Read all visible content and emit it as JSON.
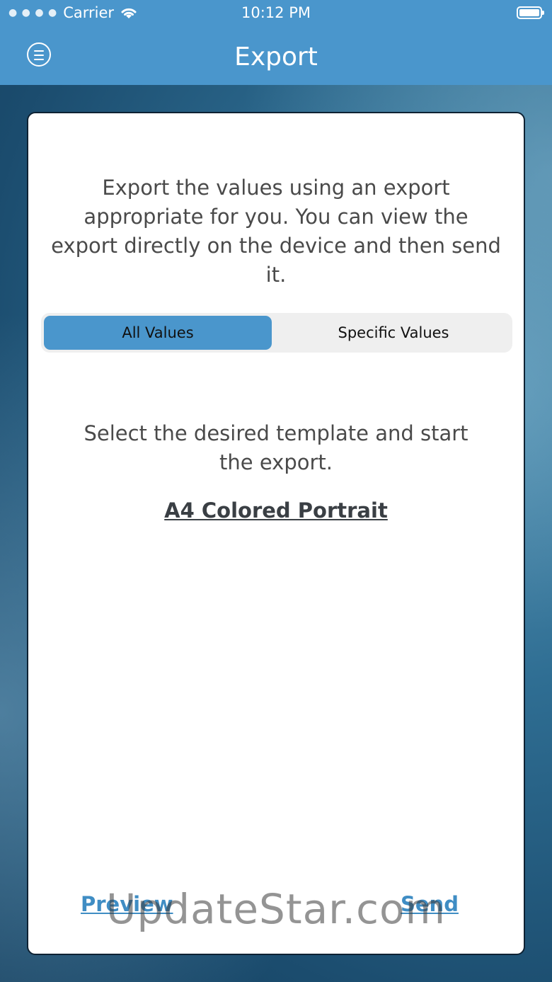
{
  "statusbar": {
    "carrier": "Carrier",
    "time": "10:12 PM"
  },
  "navbar": {
    "title": "Export",
    "menu_icon": "menu-icon"
  },
  "card": {
    "intro": "Export the values using an export appropriate for you. You can view the export directly on the device and then send it.",
    "segment": {
      "options": [
        "All Values",
        "Specific Values"
      ],
      "selected": "All Values"
    },
    "select_text": "Select the desired template and start the export.",
    "template": "A4 Colored Portrait",
    "preview_label": "Preview",
    "send_label": "Send"
  },
  "watermark": "UpdateStar.com",
  "colors": {
    "accent": "#4a96cc",
    "link": "#3f8dc4"
  }
}
